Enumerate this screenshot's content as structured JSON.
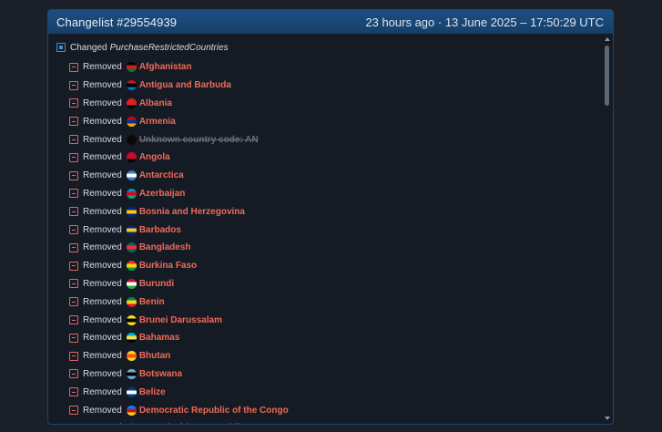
{
  "header": {
    "title": "Changelist #29554939",
    "time": "23 hours ago · 13 June 2025 – 17:50:29 UTC"
  },
  "change": {
    "prefix": "Changed",
    "field": "PurchaseRestrictedCountries"
  },
  "removed_label": "Removed",
  "items": [
    {
      "name": "Afghanistan",
      "flag": [
        "#000000",
        "#d32011",
        "#007a36"
      ],
      "icon": "afghanistan-flag-icon"
    },
    {
      "name": "Antigua and Barbuda",
      "flag": [
        "#ce1126",
        "#000000",
        "#0072c6"
      ],
      "icon": "antigua-and-barbuda-flag-icon"
    },
    {
      "name": "Albania",
      "flag": [
        "#e41e20",
        "#e41e20",
        "#000000"
      ],
      "icon": "albania-flag-icon"
    },
    {
      "name": "Armenia",
      "flag": [
        "#d90012",
        "#0033a0",
        "#f2a800"
      ],
      "icon": "armenia-flag-icon"
    },
    {
      "name": "Unknown country code: AN",
      "flag": [
        "#0a0a0a",
        "#0a0a0a",
        "#0a0a0a"
      ],
      "icon": "unknown-flag-icon",
      "unknown": true
    },
    {
      "name": "Angola",
      "flag": [
        "#cc092f",
        "#cc092f",
        "#000000"
      ],
      "icon": "angola-flag-icon"
    },
    {
      "name": "Antarctica",
      "flag": [
        "#3a7dce",
        "#ffffff",
        "#3a7dce"
      ],
      "icon": "antarctica-flag-icon"
    },
    {
      "name": "Azerbaijan",
      "flag": [
        "#0092bc",
        "#e4002b",
        "#00af66"
      ],
      "icon": "azerbaijan-flag-icon"
    },
    {
      "name": "Bosnia and Herzegovina",
      "flag": [
        "#002395",
        "#fecb00",
        "#002395"
      ],
      "icon": "bosnia-and-herzegovina-flag-icon"
    },
    {
      "name": "Barbados",
      "flag": [
        "#00267f",
        "#ffc726",
        "#00267f"
      ],
      "icon": "barbados-flag-icon"
    },
    {
      "name": "Bangladesh",
      "flag": [
        "#006a4e",
        "#f42a41",
        "#006a4e"
      ],
      "icon": "bangladesh-flag-icon"
    },
    {
      "name": "Burkina Faso",
      "flag": [
        "#ef2b2d",
        "#fcd116",
        "#009e49"
      ],
      "icon": "burkina-faso-flag-icon"
    },
    {
      "name": "Burundi",
      "flag": [
        "#ce1126",
        "#ffffff",
        "#1eb53a"
      ],
      "icon": "burundi-flag-icon"
    },
    {
      "name": "Benin",
      "flag": [
        "#008751",
        "#fcd116",
        "#e8112d"
      ],
      "icon": "benin-flag-icon"
    },
    {
      "name": "Brunei Darussalam",
      "flag": [
        "#f7e017",
        "#000000",
        "#f7e017"
      ],
      "icon": "brunei-flag-icon"
    },
    {
      "name": "Bahamas",
      "flag": [
        "#00abc9",
        "#fae042",
        "#000000"
      ],
      "icon": "bahamas-flag-icon"
    },
    {
      "name": "Bhutan",
      "flag": [
        "#ffd520",
        "#ff4e12",
        "#ffd520"
      ],
      "icon": "bhutan-flag-icon"
    },
    {
      "name": "Botswana",
      "flag": [
        "#75aadb",
        "#000000",
        "#75aadb"
      ],
      "icon": "botswana-flag-icon"
    },
    {
      "name": "Belize",
      "flag": [
        "#003f87",
        "#ffffff",
        "#003f87"
      ],
      "icon": "belize-flag-icon"
    },
    {
      "name": "Democratic Republic of the Congo",
      "flag": [
        "#007fff",
        "#ce1021",
        "#f7d618"
      ],
      "icon": "dr-congo-flag-icon"
    },
    {
      "name": "Central African Republic",
      "flag": [
        "#003082",
        "#ffce00",
        "#289728"
      ],
      "icon": "central-african-republic-flag-icon"
    }
  ]
}
